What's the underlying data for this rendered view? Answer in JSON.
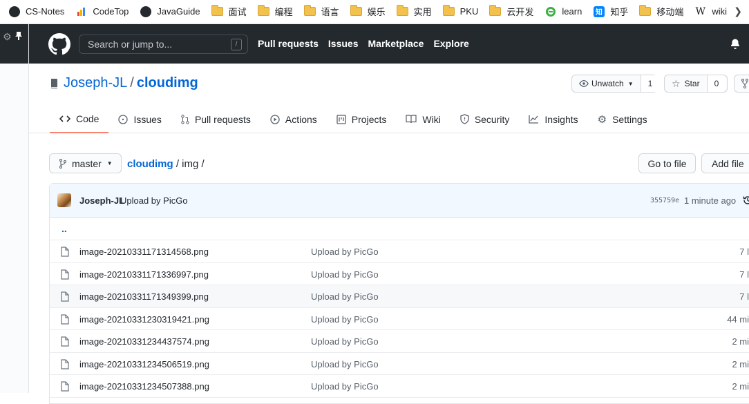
{
  "bookmarks": [
    {
      "label": "CS-Notes",
      "icon": "github-icon"
    },
    {
      "label": "CodeTop",
      "icon": "codetop-icon"
    },
    {
      "label": "JavaGuide",
      "icon": "github-icon"
    },
    {
      "label": "面试",
      "icon": "folder-icon"
    },
    {
      "label": "编程",
      "icon": "folder-icon"
    },
    {
      "label": "语言",
      "icon": "folder-icon"
    },
    {
      "label": "娱乐",
      "icon": "folder-icon"
    },
    {
      "label": "实用",
      "icon": "folder-icon"
    },
    {
      "label": "PKU",
      "icon": "folder-icon"
    },
    {
      "label": "云开发",
      "icon": "folder-icon"
    },
    {
      "label": "learn",
      "icon": "learn-icon"
    },
    {
      "label": "知乎",
      "icon": "zhihu-icon"
    },
    {
      "label": "移动端",
      "icon": "folder-icon"
    },
    {
      "label": "wiki",
      "icon": "wikipedia-icon"
    }
  ],
  "header": {
    "search_placeholder": "Search or jump to...",
    "search_shortcut": "/",
    "nav": [
      "Pull requests",
      "Issues",
      "Marketplace",
      "Explore"
    ]
  },
  "repo": {
    "owner": "Joseph-JL",
    "separator": "/",
    "name": "cloudimg",
    "unwatch_label": "Unwatch",
    "watch_count": "1",
    "star_label": "Star",
    "star_count": "0"
  },
  "tabs": [
    {
      "label": "Code",
      "icon": "code-icon"
    },
    {
      "label": "Issues",
      "icon": "issue-icon"
    },
    {
      "label": "Pull requests",
      "icon": "pull-request-icon"
    },
    {
      "label": "Actions",
      "icon": "play-icon"
    },
    {
      "label": "Projects",
      "icon": "project-icon"
    },
    {
      "label": "Wiki",
      "icon": "book-icon"
    },
    {
      "label": "Security",
      "icon": "shield-icon"
    },
    {
      "label": "Insights",
      "icon": "graph-icon"
    },
    {
      "label": "Settings",
      "icon": "gear-icon"
    }
  ],
  "filenav": {
    "branch": "master",
    "path_repo": "cloudimg",
    "path_rest": " / img /",
    "goto_file": "Go to file",
    "add_file": "Add file"
  },
  "commit": {
    "author": "Joseph-JL",
    "message": "Upload by PicGo",
    "sha": "355759e",
    "ago": "1 minute ago"
  },
  "up_link": "..",
  "files": [
    {
      "name": "image-20210331171314568.png",
      "message": "Upload by PicGo",
      "age": "7 l"
    },
    {
      "name": "image-20210331171336997.png",
      "message": "Upload by PicGo",
      "age": "7 l"
    },
    {
      "name": "image-20210331171349399.png",
      "message": "Upload by PicGo",
      "age": "7 l"
    },
    {
      "name": "image-20210331230319421.png",
      "message": "Upload by PicGo",
      "age": "44 mi"
    },
    {
      "name": "image-20210331234437574.png",
      "message": "Upload by PicGo",
      "age": "2 mi"
    },
    {
      "name": "image-20210331234506519.png",
      "message": "Upload by PicGo",
      "age": "2 mi"
    },
    {
      "name": "image-20210331234507388.png",
      "message": "Upload by PicGo",
      "age": "2 mi"
    }
  ],
  "colors": {
    "header_bg": "#24292e",
    "link": "#0366d6",
    "active_tab": "#f9826c",
    "commit_bg": "#f1f8ff"
  }
}
